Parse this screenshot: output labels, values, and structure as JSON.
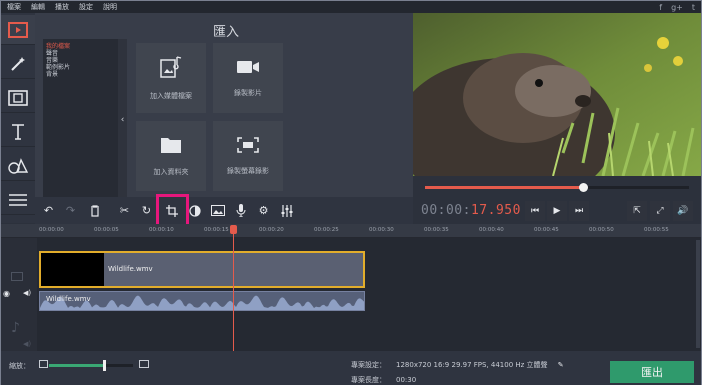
{
  "menu": [
    "檔案",
    "編輯",
    "播放",
    "設定",
    "說明"
  ],
  "social_icons": [
    "facebook-icon",
    "google-plus-icon",
    "twitter-icon"
  ],
  "sidebar": [
    {
      "icon": "film-import-icon"
    },
    {
      "icon": "magic-wand-icon"
    },
    {
      "icon": "filmstrip-icon"
    },
    {
      "icon": "text-icon"
    },
    {
      "icon": "shapes-icon"
    },
    {
      "icon": "menu-icon"
    }
  ],
  "import": {
    "title": "匯入",
    "folders": [
      "我的檔案",
      "聲音",
      "音樂",
      "範例影片",
      "背景"
    ],
    "selected_folder": "我的檔案",
    "tiles": [
      {
        "label": "加入媒體檔案",
        "icon": "media-file-icon"
      },
      {
        "label": "錄製影片",
        "icon": "video-camera-icon"
      },
      {
        "label": "加入資料夾",
        "icon": "folder-icon"
      },
      {
        "label": "錄製螢幕錄影",
        "icon": "screen-record-icon"
      }
    ]
  },
  "player": {
    "timecode_dim": "00:00:",
    "timecode_red": "17.950",
    "progress": 0.6
  },
  "toolbar": [
    "undo-icon",
    "redo-icon",
    "trash-icon",
    "scissors-icon",
    "rotate-icon",
    "crop-icon",
    "color-adjust-icon",
    "image-icon",
    "microphone-icon",
    "gear-icon",
    "equalizer-icon"
  ],
  "ruler": [
    "00:00:00",
    "00:00:05",
    "00:00:10",
    "00:00:15",
    "00:00:20",
    "00:00:25",
    "00:00:30",
    "00:00:35",
    "00:00:40",
    "00:00:45",
    "00:00:50",
    "00:00:55"
  ],
  "timeline": {
    "video_clip": "Wildlife.wmv",
    "audio_clip": "Wildlife.wmv"
  },
  "status": {
    "zoom_label": "縮放：",
    "zoom_level": 0.65,
    "settings_label": "專案設定：",
    "settings_value": "1280x720 16:9 29.97 FPS, 44100 Hz 立體聲",
    "length_label": "專案長度：",
    "length_value": "00:30",
    "export_label": "匯出"
  },
  "colors": {
    "accent": "#e45b4c",
    "export": "#2f9a6c",
    "highlight": "#e6177c",
    "clip_border": "#e2ad2b"
  }
}
